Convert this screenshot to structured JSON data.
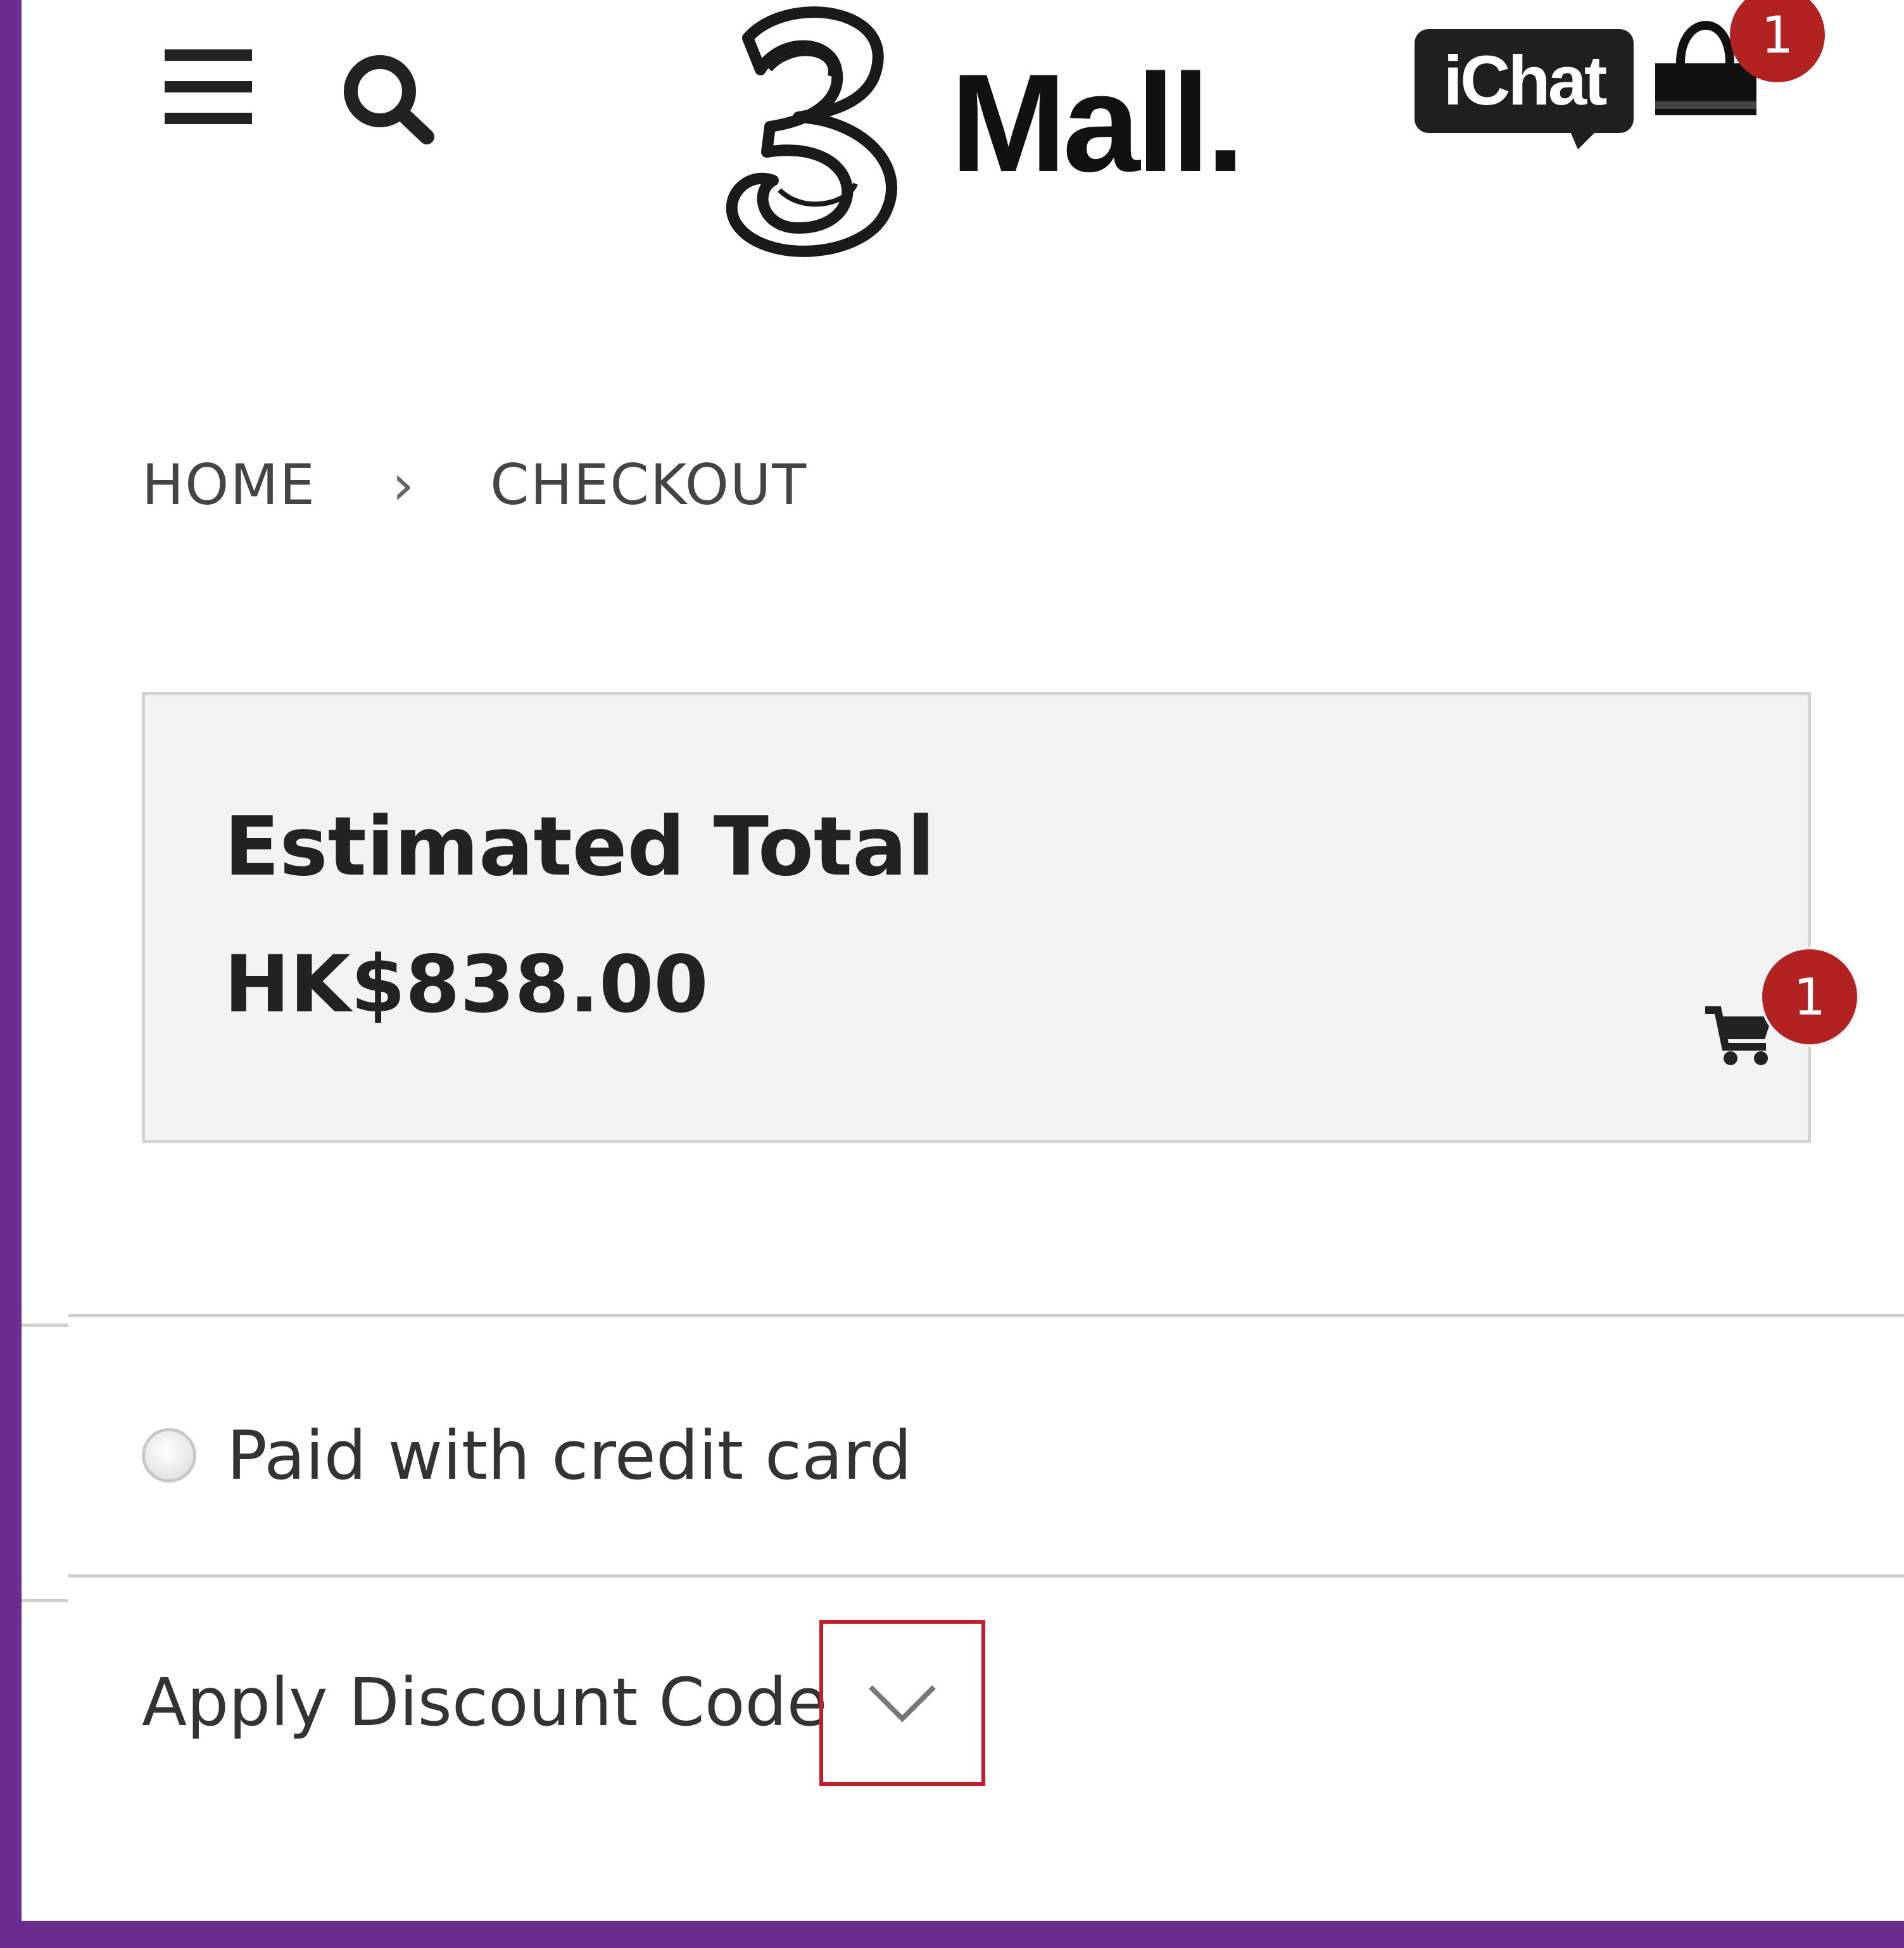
{
  "header": {
    "logo_text": "Mall.",
    "chat_label": "iChat",
    "bag_count": "1",
    "icons": [
      "menu-icon",
      "search-icon",
      "shopping-bag-icon"
    ]
  },
  "breadcrumb": {
    "home": "HOME",
    "separator": "›",
    "current": "CHECKOUT"
  },
  "summary": {
    "label": "Estimated Total",
    "value": "HK$838.00",
    "cart_count": "1"
  },
  "payment": {
    "option_label": "Paid with credit card",
    "selected": false
  },
  "discount": {
    "label": "Apply Discount Code",
    "icon": "chevron-down-icon"
  },
  "colors": {
    "frame": "#6a2d8f",
    "badge": "#b32222",
    "highlight": "#c21f2e",
    "summary_bg": "#f3f3f3"
  }
}
